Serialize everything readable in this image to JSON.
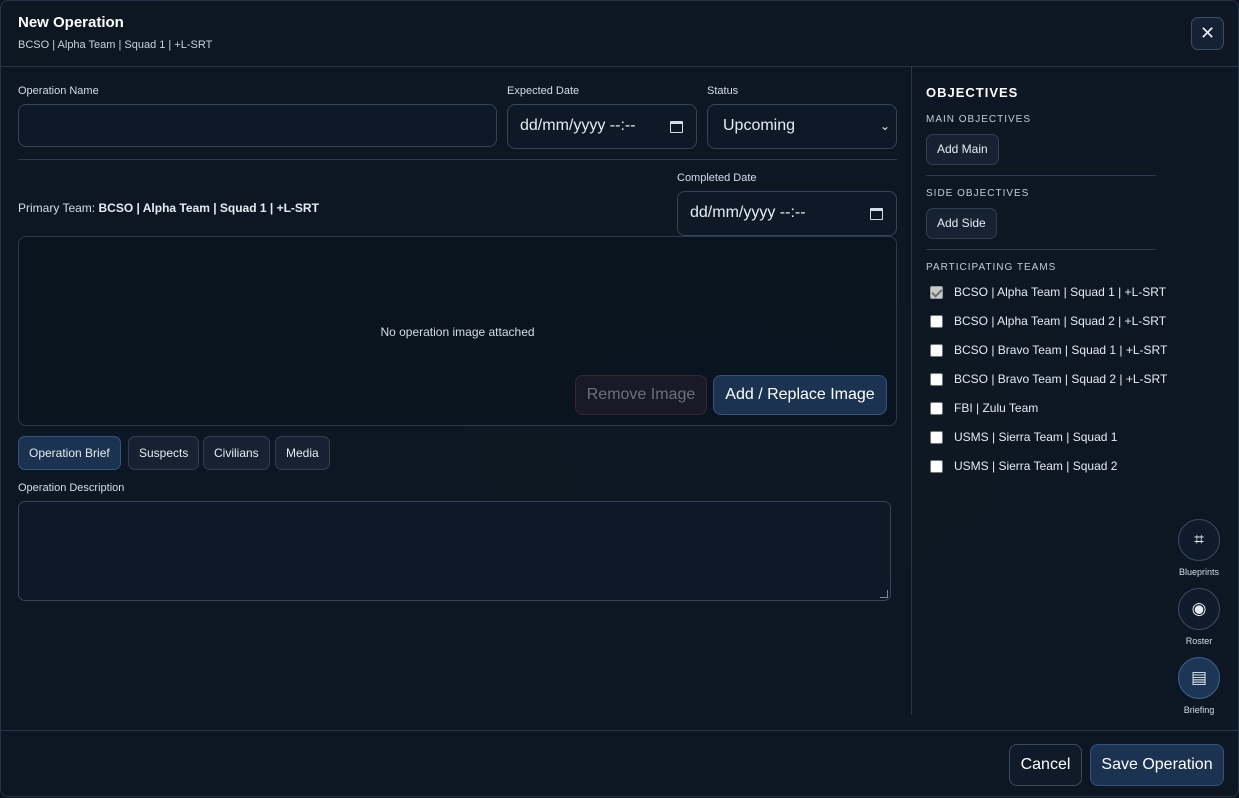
{
  "modal": {
    "title": "New Operation",
    "subtitle": "BCSO | Alpha Team | Squad 1 | +L-SRT",
    "close_glyph": "✕"
  },
  "form": {
    "operation_name": {
      "label": "Operation Name",
      "value": ""
    },
    "expected_date": {
      "label": "Expected Date",
      "placeholder": "dd/mm/yyyy --:--"
    },
    "status": {
      "label": "Status",
      "selected": "Upcoming"
    },
    "completed_date": {
      "label": "Completed Date",
      "placeholder": "dd/mm/yyyy --:--"
    },
    "primary_team": {
      "label": "Primary Team:",
      "value": "BCSO | Alpha Team | Squad 1 | +L-SRT"
    },
    "image": {
      "empty_text": "No operation image attached",
      "remove_label": "Remove Image",
      "add_label": "Add / Replace Image"
    },
    "tabs": [
      {
        "label": "Operation Brief",
        "active": true
      },
      {
        "label": "Suspects",
        "active": false
      },
      {
        "label": "Civilians",
        "active": false
      },
      {
        "label": "Media",
        "active": false
      }
    ],
    "description": {
      "label": "Operation Description",
      "value": ""
    }
  },
  "objectives": {
    "title": "OBJECTIVES",
    "main": {
      "heading": "MAIN OBJECTIVES",
      "button": "Add Main"
    },
    "side": {
      "heading": "SIDE OBJECTIVES",
      "button": "Add Side"
    },
    "teams": {
      "heading": "PARTICIPATING TEAMS",
      "items": [
        {
          "label": "BCSO | Alpha Team | Squad 1 | +L-SRT",
          "checked": true,
          "disabled": true
        },
        {
          "label": "BCSO | Alpha Team | Squad 2 | +L-SRT",
          "checked": false
        },
        {
          "label": "BCSO | Bravo Team | Squad 1 | +L-SRT",
          "checked": false
        },
        {
          "label": "BCSO | Bravo Team | Squad 2 | +L-SRT",
          "checked": false
        },
        {
          "label": "FBI | Zulu Team",
          "checked": false
        },
        {
          "label": "USMS | Sierra Team | Squad 1",
          "checked": false
        },
        {
          "label": "USMS | Sierra Team | Squad 2",
          "checked": false
        }
      ]
    }
  },
  "floating_nav": [
    {
      "label": "Blueprints",
      "icon": "hash-icon",
      "glyph": "⌗",
      "active": false
    },
    {
      "label": "Roster",
      "icon": "record-icon",
      "glyph": "◉",
      "active": false
    },
    {
      "label": "Briefing",
      "icon": "document-icon",
      "glyph": "▤",
      "active": true
    }
  ],
  "footer": {
    "cancel_label": "Cancel",
    "save_label": "Save Operation"
  },
  "colors": {
    "background": "#0b1522",
    "panel": "#0d1723",
    "accent": "#1b3350",
    "border": "#344459"
  }
}
